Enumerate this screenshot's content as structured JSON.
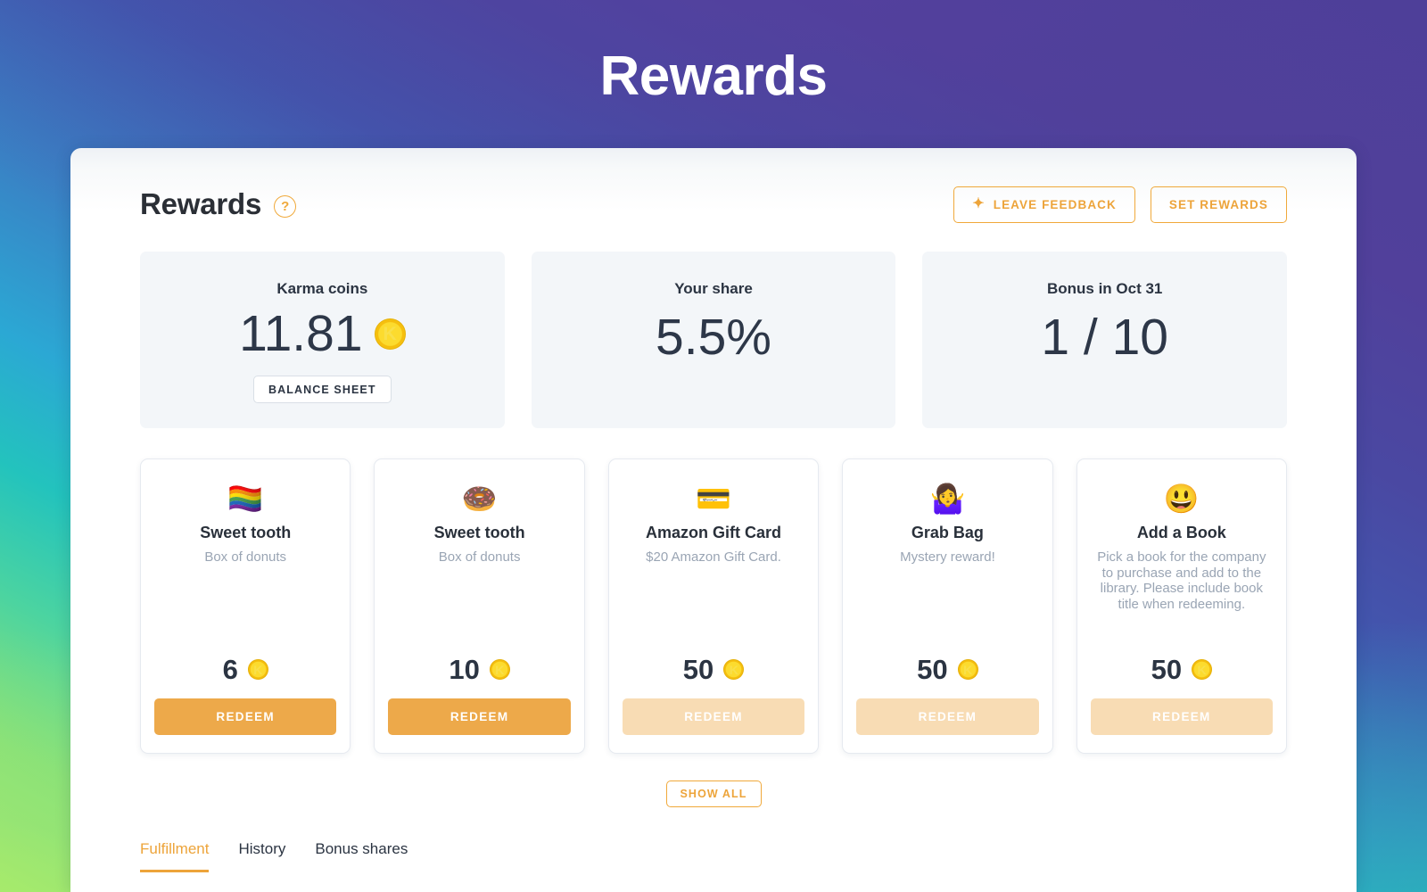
{
  "page": {
    "title": "Rewards"
  },
  "panel": {
    "title": "Rewards",
    "help_icon": "question-mark-circle-icon",
    "actions": [
      {
        "label": "LEAVE FEEDBACK",
        "icon": "sparkle-icon",
        "icon_glyph": "✦"
      },
      {
        "label": "SET REWARDS",
        "icon": null,
        "icon_glyph": ""
      }
    ]
  },
  "stats": [
    {
      "label": "Karma coins",
      "value": "11.81",
      "coin": "K",
      "button": "BALANCE SHEET"
    },
    {
      "label": "Your share",
      "value": "5.5%",
      "coin": null,
      "button": null
    },
    {
      "label": "Bonus in Oct 31",
      "value": "1 / 10",
      "coin": null,
      "button": null
    }
  ],
  "rewards": [
    {
      "emoji": "🏳️‍🌈",
      "emoji_name": "rainbow-flag-emoji",
      "title": "Sweet tooth",
      "desc": "Box of donuts",
      "price": "6",
      "coin": "K",
      "redeem_label": "REDEEM",
      "enabled": true
    },
    {
      "emoji": "🍩",
      "emoji_name": "doughnut-emoji",
      "title": "Sweet tooth",
      "desc": "Box of donuts",
      "price": "10",
      "coin": "K",
      "redeem_label": "REDEEM",
      "enabled": true
    },
    {
      "emoji": "💳",
      "emoji_name": "credit-card-emoji",
      "title": "Amazon Gift Card",
      "desc": "$20 Amazon Gift Card.",
      "price": "50",
      "coin": "K",
      "redeem_label": "REDEEM",
      "enabled": false
    },
    {
      "emoji": "🤷‍♀️",
      "emoji_name": "woman-shrugging-emoji",
      "title": "Grab Bag",
      "desc": "Mystery reward!",
      "price": "50",
      "coin": "K",
      "redeem_label": "REDEEM",
      "enabled": false
    },
    {
      "emoji": "😃",
      "emoji_name": "grinning-face-emoji",
      "title": "Add a Book",
      "desc": "Pick a book for the company to purchase and add to the library. Please include book title when redeeming.",
      "price": "50",
      "coin": "K",
      "redeem_label": "REDEEM",
      "enabled": false
    }
  ],
  "show_all": {
    "label": "SHOW ALL"
  },
  "tabs": [
    {
      "label": "Fulfillment",
      "active": true
    },
    {
      "label": "History",
      "active": false
    },
    {
      "label": "Bonus shares",
      "active": false
    }
  ],
  "colors": {
    "accent": "#eda43a",
    "accent_border": "#f0a93b",
    "redeem": "#eda94a",
    "redeem_disabled": "#f8dcb4",
    "coin_gold": "#fcdb2e",
    "text_dark": "#2b3442",
    "text_muted": "#9aa5b4",
    "stat_bg": "#f3f6f9"
  }
}
